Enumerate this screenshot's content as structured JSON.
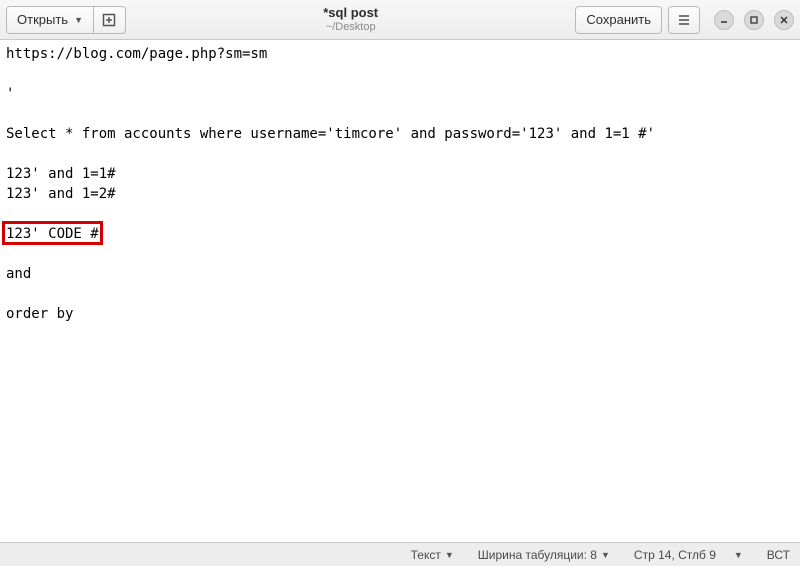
{
  "header": {
    "open_label": "Открыть",
    "save_label": "Сохранить",
    "title": "*sql post",
    "subtitle": "~/Desktop"
  },
  "editor": {
    "lines": [
      "https://blog.com/page.php?sm=sm",
      "",
      "'",
      "",
      "Select * from accounts where username='timcore' and password='123' and 1=1 #'",
      "",
      "123' and 1=1#",
      "123' and 1=2#",
      "",
      "123' CODE #",
      "",
      "and",
      "",
      "order by "
    ],
    "highlight_line_index": 9
  },
  "statusbar": {
    "syntax_label": "Текст",
    "tab_label": "Ширина табуляции: 8",
    "position_label": "Стр 14, Стлб 9",
    "insert_mode": "ВСТ"
  }
}
